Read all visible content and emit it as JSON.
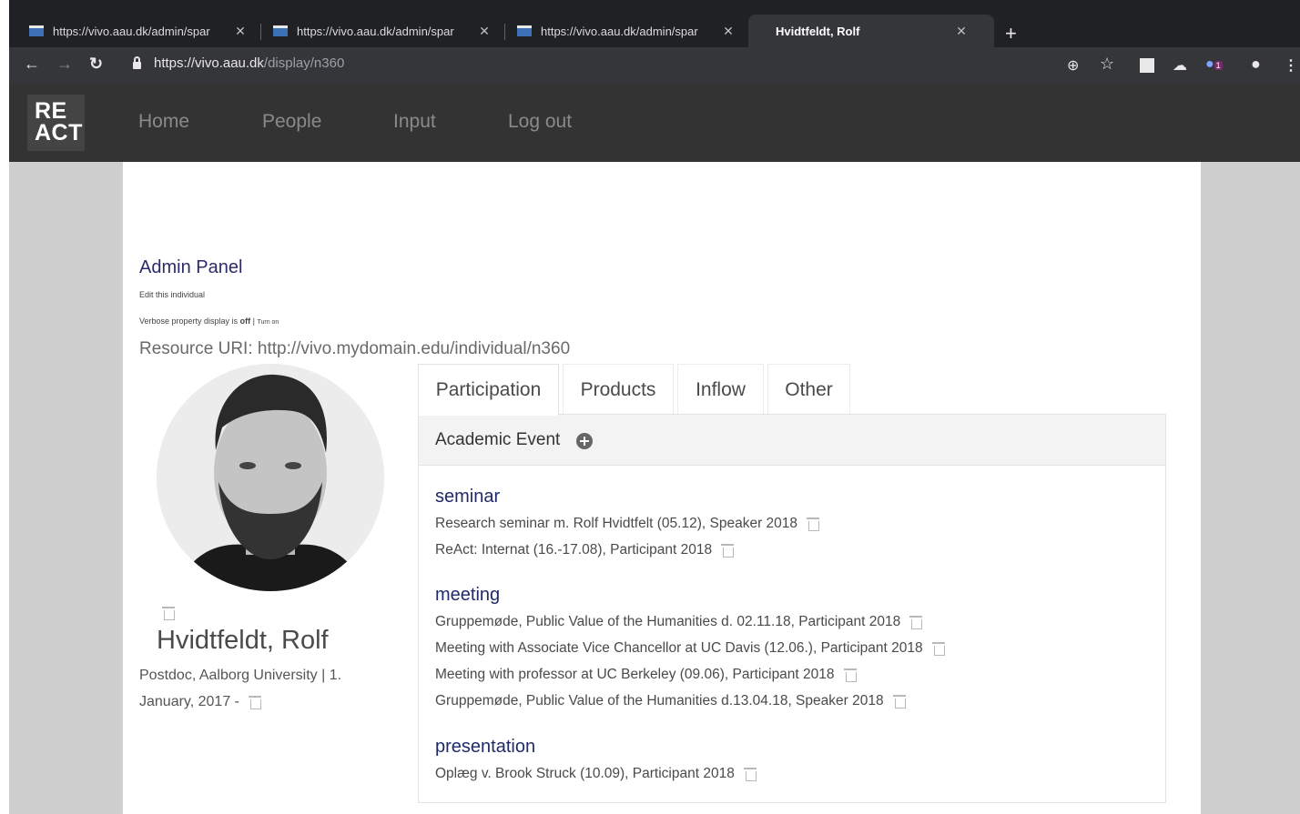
{
  "browser": {
    "tabs": [
      {
        "title": "https://vivo.aau.dk/admin/spar"
      },
      {
        "title": "https://vivo.aau.dk/admin/spar"
      },
      {
        "title": "https://vivo.aau.dk/admin/spar"
      },
      {
        "title": "Hvidtfeldt, Rolf"
      }
    ],
    "url_host": "https://vivo.aau.dk",
    "url_path": "/display/n360",
    "extension_badge": "1"
  },
  "site": {
    "logo_line1": "RE",
    "logo_line2": "ACT",
    "nav": [
      "Home",
      "People",
      "Input",
      "Log out"
    ]
  },
  "admin": {
    "title": "Admin Panel",
    "edit_link": "Edit this individual",
    "verbose_prefix": "Verbose property display is",
    "verbose_state": "off",
    "verbose_sep": "|",
    "verbose_toggle": "Turn on",
    "resource_uri": "Resource URI: http://vivo.mydomain.edu/individual/n360"
  },
  "profile": {
    "name": "Hvidtfeldt, Rolf",
    "position_line1": "Postdoc, Aalborg University | 1.",
    "position_line2": "January, 2017 -"
  },
  "tabs": [
    "Participation",
    "Products",
    "Inflow",
    "Other"
  ],
  "panel": {
    "title": "Academic Event",
    "groups": [
      {
        "name": "seminar",
        "entries": [
          "Research seminar m. Rolf Hvidtfelt (05.12), Speaker 2018",
          "ReAct: Internat (16.-17.08), Participant 2018"
        ]
      },
      {
        "name": "meeting",
        "entries": [
          "Gruppemøde, Public Value of the Humanities d. 02.11.18, Participant 2018",
          "Meeting with Associate Vice Chancellor at UC Davis (12.06.), Participant 2018",
          "Meeting with professor at UC Berkeley (09.06), Participant 2018",
          "Gruppemøde, Public Value of the Humanities d.13.04.18, Speaker 2018"
        ]
      },
      {
        "name": "presentation",
        "entries": [
          "Oplæg v. Brook Struck (10.09), Participant 2018"
        ]
      }
    ]
  }
}
